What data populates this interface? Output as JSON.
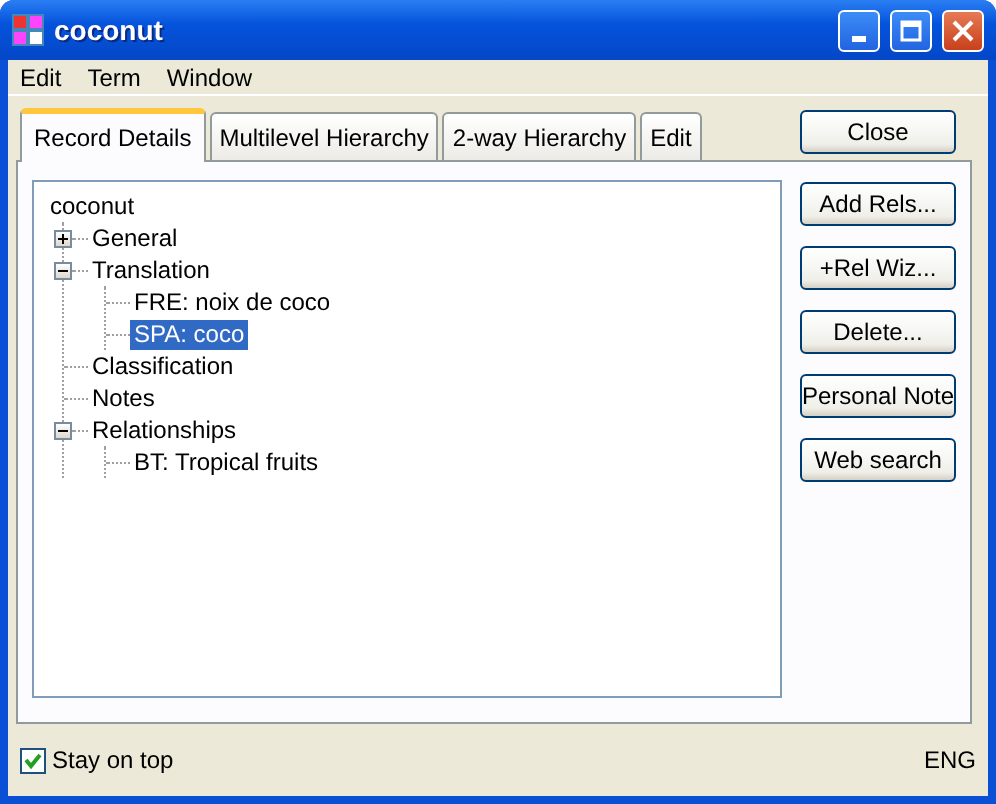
{
  "window": {
    "title": "coconut"
  },
  "menu": [
    "Edit",
    "Term",
    "Window"
  ],
  "tabs": [
    {
      "label": "Record Details",
      "selected": true
    },
    {
      "label": "Multilevel Hierarchy",
      "selected": false
    },
    {
      "label": "2-way Hierarchy",
      "selected": false
    },
    {
      "label": "Edit",
      "selected": false
    }
  ],
  "close_button": "Close",
  "tree": {
    "label": "coconut",
    "selected": false,
    "children": [
      {
        "label": "General",
        "expanded": false,
        "selected": false
      },
      {
        "label": "Translation",
        "expanded": true,
        "selected": false,
        "children": [
          {
            "label": "FRE: noix de coco",
            "selected": false
          },
          {
            "label": "SPA: coco",
            "selected": true
          }
        ]
      },
      {
        "label": "Classification",
        "selected": false
      },
      {
        "label": "Notes",
        "selected": false
      },
      {
        "label": "Relationships",
        "expanded": true,
        "selected": false,
        "children": [
          {
            "label": "BT: Tropical fruits",
            "selected": false
          }
        ]
      }
    ]
  },
  "side_buttons": [
    "Add Rels...",
    "+Rel Wiz...",
    "Delete...",
    "Personal Note",
    "Web search"
  ],
  "stay_on_top": {
    "label": "Stay on top",
    "checked": true
  },
  "language": "ENG"
}
